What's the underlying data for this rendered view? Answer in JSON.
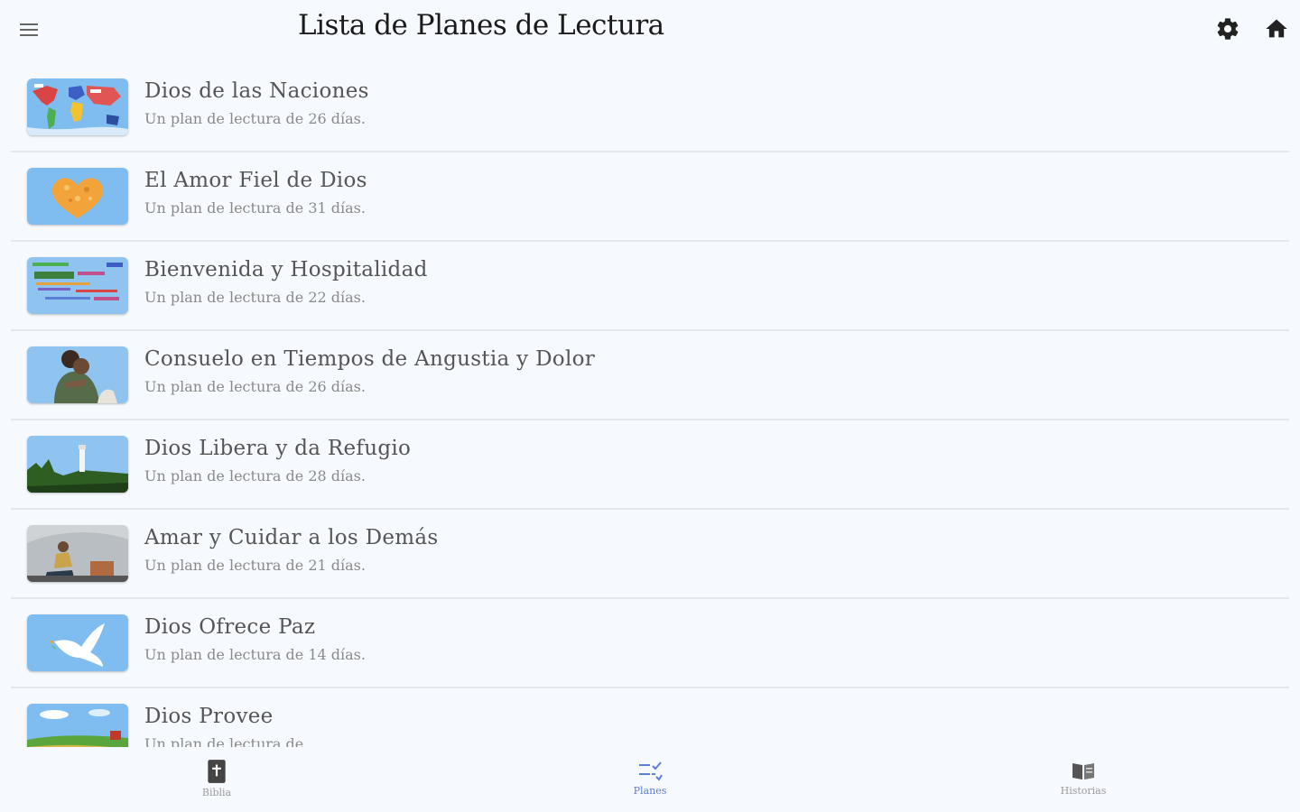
{
  "header": {
    "title": "Lista de Planes de Lectura",
    "menu_icon": "hamburger-menu-icon",
    "settings_icon": "gear-icon",
    "home_icon": "home-icon"
  },
  "plans": [
    {
      "title": "Dios de las Naciones",
      "subtitle": "Un plan de lectura de 26 días.",
      "thumbnail": "world-map-flags-image"
    },
    {
      "title": "El Amor Fiel de Dios",
      "subtitle": "Un plan de lectura de 31 días.",
      "thumbnail": "heart-image"
    },
    {
      "title": "Bienvenida y Hospitalidad",
      "subtitle": "Un plan de lectura de 22 días.",
      "thumbnail": "welcome-words-image"
    },
    {
      "title": "Consuelo en Tiempos de Angustia y Dolor",
      "subtitle": "Un plan de lectura de 26 días.",
      "thumbnail": "embrace-image"
    },
    {
      "title": "Dios Libera y da Refugio",
      "subtitle": "Un plan de lectura de 28 días.",
      "thumbnail": "lighthouse-image"
    },
    {
      "title": "Amar y Cuidar a los Demás",
      "subtitle": "Un plan de lectura de 21 días.",
      "thumbnail": "person-sitting-image"
    },
    {
      "title": "Dios Ofrece Paz",
      "subtitle": "Un plan de lectura de 14 días.",
      "thumbnail": "dove-image"
    },
    {
      "title": "Dios Provee",
      "subtitle": "Un plan de lectura de",
      "thumbnail": "farm-landscape-image"
    }
  ],
  "bottom_nav": {
    "items": [
      {
        "label": "Biblia",
        "icon": "bible-icon",
        "active": false
      },
      {
        "label": "Planes",
        "icon": "plan-checklist-icon",
        "active": true
      },
      {
        "label": "Historias",
        "icon": "open-book-icon",
        "active": false
      }
    ]
  },
  "colors": {
    "background": "#f6f9fd",
    "accent": "#5b7fd6",
    "thumb_blue": "#7fbdf0"
  }
}
